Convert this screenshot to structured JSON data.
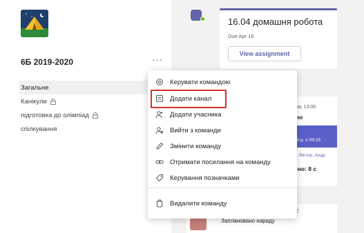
{
  "team": {
    "name": "6Б 2019-2020",
    "more_label": "···",
    "avatar_icon": "tent-camping-icon"
  },
  "channels": [
    {
      "label": "Загальне",
      "active": true,
      "private": false
    },
    {
      "label": "Канікули",
      "active": false,
      "private": true
    },
    {
      "label": "підготовка до олімпіад",
      "active": false,
      "private": true
    },
    {
      "label": "спілкування",
      "active": false,
      "private": false
    }
  ],
  "assignment": {
    "title": "16.04 домашня робота",
    "due": "Due Apr 16",
    "button_label": "View assignment"
  },
  "feed": {
    "date": "ра, 13:06",
    "subtitle": "но",
    "band_text": "20 р. о 09:25",
    "names": "и, Віктор, Андр",
    "count": "ено: 8 с"
  },
  "bottom": {
    "number": "2",
    "text": "Заплановано нараду"
  },
  "menu": {
    "items": [
      {
        "label": "Керувати командою",
        "icon": "gear-icon"
      },
      {
        "label": "Додати канал",
        "icon": "add-channel-icon"
      },
      {
        "label": "Додати учасника",
        "icon": "add-person-icon"
      },
      {
        "label": "Вийти з команди",
        "icon": "leave-team-icon"
      },
      {
        "label": "Змінити команду",
        "icon": "pencil-icon"
      },
      {
        "label": "Отримати посилання на команду",
        "icon": "link-icon"
      },
      {
        "label": "Керування позначками",
        "icon": "tag-icon"
      },
      {
        "label": "Видалити команду",
        "icon": "trash-icon"
      }
    ]
  },
  "colors": {
    "brand": "#6264a7",
    "highlight": "#d9302c",
    "presence": "#6bb700",
    "avatar_bg": "#2e8b3a",
    "tent": "#f2c12e"
  }
}
